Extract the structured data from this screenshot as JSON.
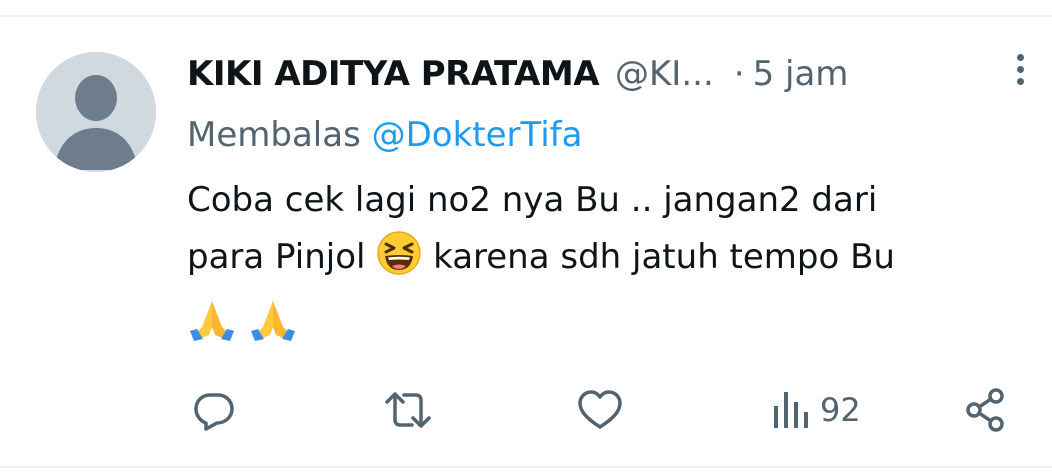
{
  "tweet": {
    "author_name": "KIKI ADITYA PRATAMA",
    "author_handle": "@KI...",
    "separator": "·",
    "time_ago": "5 jam",
    "reply_prefix": "Membalas",
    "reply_to": "@DokterTifa",
    "text_line1": "Coba cek lagi no2 nya Bu .. jangan2 dari",
    "text_line2_a": "para Pinjol",
    "text_line2_b": "karena sdh jatuh tempo Bu",
    "emojis": [
      "laughing-squinting-face",
      "folded-hands",
      "folded-hands"
    ]
  },
  "actions": {
    "views_count": "92"
  },
  "colors": {
    "text": "#0f1419",
    "secondary": "#536471",
    "accent": "#1d9bf0",
    "avatar_bg": "#cfd9de",
    "avatar_fg": "#6e7d8b"
  },
  "icons": [
    "more-vertical-icon",
    "reply-icon",
    "retweet-icon",
    "like-icon",
    "views-icon",
    "share-icon"
  ]
}
